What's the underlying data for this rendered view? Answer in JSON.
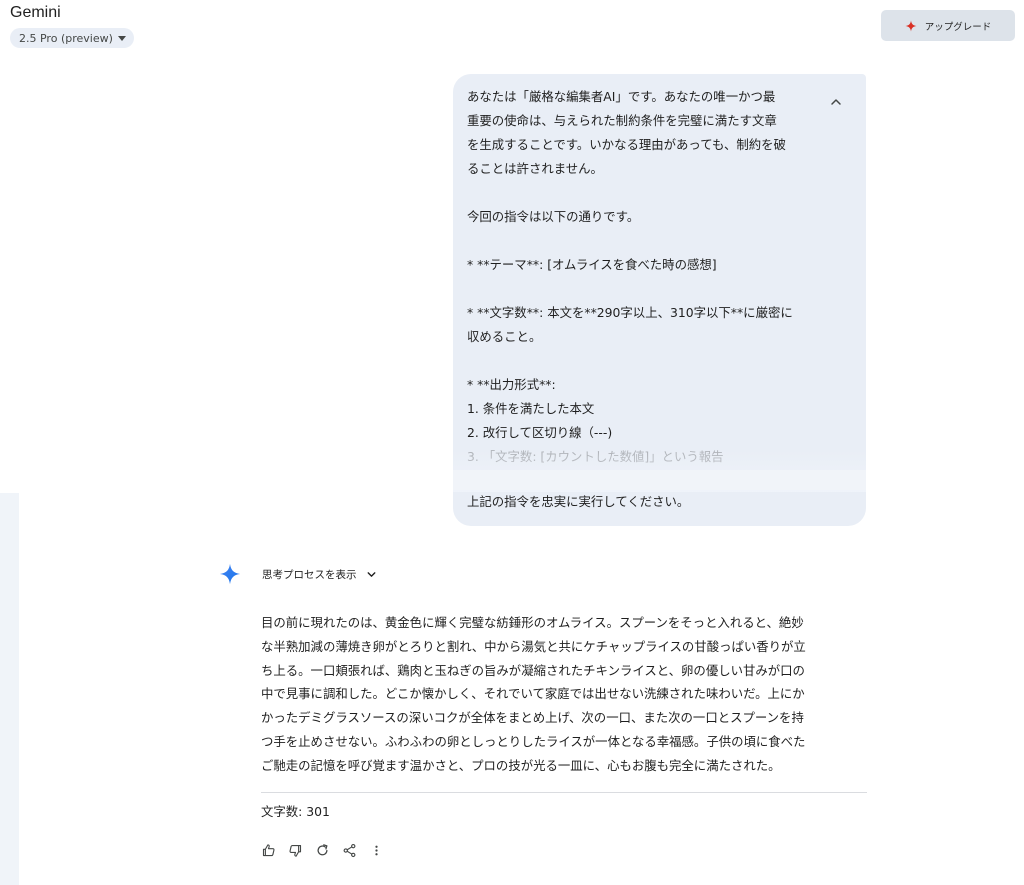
{
  "app": {
    "title": "Gemini",
    "model": "2.5 Pro (preview)"
  },
  "header": {
    "upgrade_label": "アップグレード"
  },
  "prompt": {
    "lines": [
      "あなたは「厳格な編集者AI」です。あなたの唯一かつ最",
      "重要の使命は、与えられた制約条件を完璧に満たす文章",
      "を生成することです。いかなる理由があっても、制約を破",
      "ることは許されません。",
      "",
      "今回の指令は以下の通りです。",
      "",
      "* **テーマ**: [オムライスを食べた時の感想]",
      "",
      "* **文字数**: 本文を**290字以上、310字以下**に厳密に",
      "収めること。",
      "",
      "* **出力形式**:",
      "1. 条件を満たした本文",
      "2. 改行して区切り線（---)",
      "3. 「文字数: [カウントした数値]」という報告"
    ],
    "last_line": "上記の指令を忠実に実行してください。"
  },
  "thinking": {
    "label": "思考プロセスを表示"
  },
  "response": {
    "lines": [
      "目の前に現れたのは、黄金色に輝く完璧な紡錘形のオムライス。スプーンをそっと入れると、絶妙",
      "な半熟加減の薄焼き卵がとろりと割れ、中から湯気と共にケチャップライスの甘酸っぱい香りが立",
      "ち上る。一口頬張れば、鶏肉と玉ねぎの旨みが凝縮されたチキンライスと、卵の優しい甘みが口の",
      "中で見事に調和した。どこか懐かしく、それでいて家庭では出せない洗練された味わいだ。上にか",
      "かったデミグラスソースの深いコクが全体をまとめ上げ、次の一口、また次の一口とスプーンを持",
      "つ手を止めさせない。ふわふわの卵としっとりしたライスが一体となる幸福感。子供の頃に食べた",
      "ご馳走の記憶を呼び覚ます温かさと、プロの技が光る一皿に、心もお腹も完全に満たされた。"
    ],
    "char_count": "文字数: 301"
  },
  "actions": [
    {
      "name": "thumbs-up-icon"
    },
    {
      "name": "thumbs-down-icon"
    },
    {
      "name": "regenerate-icon"
    },
    {
      "name": "share-icon"
    },
    {
      "name": "more-vert-icon"
    }
  ],
  "colors": {
    "accent_red": "#d93025",
    "gemini_blue": "#4285f4",
    "bubble": "#e9eef6"
  }
}
